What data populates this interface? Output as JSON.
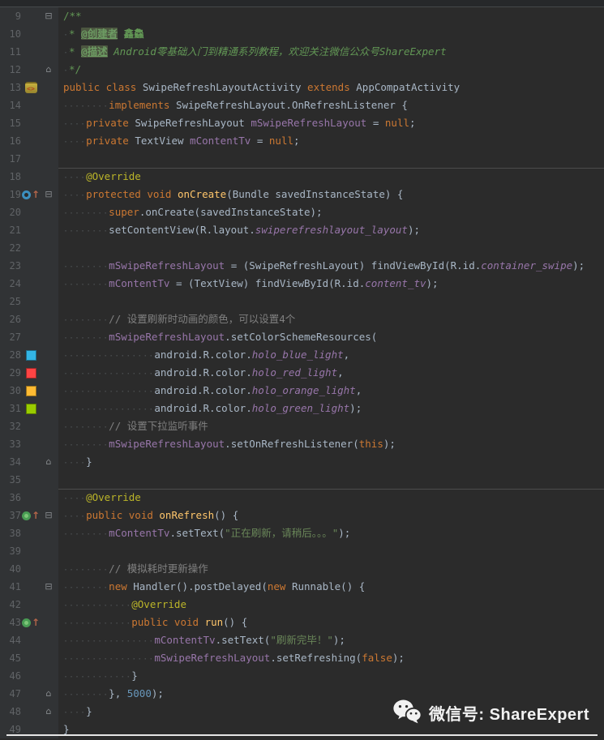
{
  "app_context": "IDE code editor (dark theme) showing Java Android source",
  "colors": {
    "background": "#2B2B2B",
    "gutter": "#313335",
    "line_number": "#606366",
    "keyword": "#CC7832",
    "plain": "#A9B7C6",
    "field": "#9876AA",
    "method_declaration": "#FFC66B",
    "annotation": "#BBB529",
    "string": "#6A8759",
    "number": "#6897BB",
    "comment": "#808080",
    "doc_comment": "#629755"
  },
  "icons": {
    "fold_collapse_glyph": "⊟",
    "fold_expand_glyph": "⌂",
    "override_arrow_glyph": "↑",
    "class_icon_glyph": "<>",
    "names": [
      "android-class-icon",
      "override-method-icon",
      "implement-method-icon",
      "fold-marker-icon",
      "color-swatch",
      "wechat-icon"
    ]
  },
  "watermark": {
    "label": "微信号: ShareExpert"
  },
  "editor": {
    "first_line": 9,
    "last_line": 49,
    "lines": [
      {
        "num": 9,
        "fold": "start",
        "segs": [
          [
            "doc",
            "/**"
          ]
        ]
      },
      {
        "num": 10,
        "segs": [
          [
            "ws",
            "·"
          ],
          [
            "doc",
            "* "
          ],
          [
            "docTag",
            "@创建者"
          ],
          [
            "doc",
            " "
          ],
          [
            "docB",
            "鑫鱻"
          ]
        ]
      },
      {
        "num": 11,
        "segs": [
          [
            "ws",
            "·"
          ],
          [
            "doc",
            "* "
          ],
          [
            "docTag",
            "@描述"
          ],
          [
            "doc",
            " "
          ],
          [
            "docI",
            "Android零基础入门到精通系列教程，欢迎关注微信公众号ShareExpert"
          ]
        ]
      },
      {
        "num": 12,
        "fold": "end",
        "segs": [
          [
            "ws",
            "·"
          ],
          [
            "doc",
            "*/"
          ]
        ]
      },
      {
        "num": 13,
        "icon": "class",
        "segs": [
          [
            "kw",
            "public class "
          ],
          [
            "plain",
            "SwipeRefreshLayoutActivity "
          ],
          [
            "kw",
            "extends "
          ],
          [
            "plain",
            "AppCompatActivity"
          ]
        ]
      },
      {
        "num": 14,
        "segs": [
          [
            "ws",
            "········"
          ],
          [
            "kw",
            "implements "
          ],
          [
            "plain",
            "SwipeRefreshLayout.OnRefreshListener {"
          ]
        ]
      },
      {
        "num": 15,
        "segs": [
          [
            "ws",
            "····"
          ],
          [
            "kw",
            "private "
          ],
          [
            "plain",
            "SwipeRefreshLayout "
          ],
          [
            "field",
            "mSwipeRefreshLayout"
          ],
          [
            "plain",
            " = "
          ],
          [
            "kw",
            "null"
          ],
          [
            "plain",
            ";"
          ]
        ]
      },
      {
        "num": 16,
        "segs": [
          [
            "ws",
            "····"
          ],
          [
            "kw",
            "private "
          ],
          [
            "plain",
            "TextView "
          ],
          [
            "field",
            "mContentTv"
          ],
          [
            "plain",
            " = "
          ],
          [
            "kw",
            "null"
          ],
          [
            "plain",
            ";"
          ]
        ]
      },
      {
        "num": 17,
        "segs": []
      },
      {
        "num": 18,
        "sep": true,
        "segs": [
          [
            "ws",
            "····"
          ],
          [
            "ann",
            "@Override"
          ]
        ]
      },
      {
        "num": 19,
        "icon": "override",
        "fold": "start",
        "segs": [
          [
            "ws",
            "····"
          ],
          [
            "kw",
            "protected void "
          ],
          [
            "method",
            "onCreate"
          ],
          [
            "plain",
            "(Bundle savedInstanceState) {"
          ]
        ]
      },
      {
        "num": 20,
        "segs": [
          [
            "ws",
            "········"
          ],
          [
            "kw",
            "super"
          ],
          [
            "plain",
            ".onCreate(savedInstanceState);"
          ]
        ]
      },
      {
        "num": 21,
        "segs": [
          [
            "ws",
            "········"
          ],
          [
            "plain",
            "setContentView(R.layout."
          ],
          [
            "fieldI",
            "swiperefreshlayout_layout"
          ],
          [
            "plain",
            ");"
          ]
        ]
      },
      {
        "num": 22,
        "segs": []
      },
      {
        "num": 23,
        "segs": [
          [
            "ws",
            "········"
          ],
          [
            "field",
            "mSwipeRefreshLayout"
          ],
          [
            "plain",
            " = (SwipeRefreshLayout) findViewById(R.id."
          ],
          [
            "fieldI",
            "container_swipe"
          ],
          [
            "plain",
            ");"
          ]
        ]
      },
      {
        "num": 24,
        "segs": [
          [
            "ws",
            "········"
          ],
          [
            "field",
            "mContentTv"
          ],
          [
            "plain",
            " = (TextView) findViewById(R.id."
          ],
          [
            "fieldI",
            "content_tv"
          ],
          [
            "plain",
            ");"
          ]
        ]
      },
      {
        "num": 25,
        "segs": []
      },
      {
        "num": 26,
        "segs": [
          [
            "ws",
            "········"
          ],
          [
            "cmt",
            "// 设置刷新时动画的颜色，可以设置4个"
          ]
        ]
      },
      {
        "num": 27,
        "segs": [
          [
            "ws",
            "········"
          ],
          [
            "field",
            "mSwipeRefreshLayout"
          ],
          [
            "plain",
            ".setColorSchemeResources("
          ]
        ]
      },
      {
        "num": 28,
        "swatch": "#33B5E5",
        "segs": [
          [
            "ws",
            "················"
          ],
          [
            "plain",
            "android.R.color."
          ],
          [
            "fieldI",
            "holo_blue_light"
          ],
          [
            "plain",
            ","
          ]
        ]
      },
      {
        "num": 29,
        "swatch": "#FF4444",
        "segs": [
          [
            "ws",
            "················"
          ],
          [
            "plain",
            "android.R.color."
          ],
          [
            "fieldI",
            "holo_red_light"
          ],
          [
            "plain",
            ","
          ]
        ]
      },
      {
        "num": 30,
        "swatch": "#FFBB33",
        "segs": [
          [
            "ws",
            "················"
          ],
          [
            "plain",
            "android.R.color."
          ],
          [
            "fieldI",
            "holo_orange_light"
          ],
          [
            "plain",
            ","
          ]
        ]
      },
      {
        "num": 31,
        "swatch": "#99CC00",
        "segs": [
          [
            "ws",
            "················"
          ],
          [
            "plain",
            "android.R.color."
          ],
          [
            "fieldI",
            "holo_green_light"
          ],
          [
            "plain",
            ");"
          ]
        ]
      },
      {
        "num": 32,
        "segs": [
          [
            "ws",
            "········"
          ],
          [
            "cmt",
            "// 设置下拉监听事件"
          ]
        ]
      },
      {
        "num": 33,
        "segs": [
          [
            "ws",
            "········"
          ],
          [
            "field",
            "mSwipeRefreshLayout"
          ],
          [
            "plain",
            ".setOnRefreshListener("
          ],
          [
            "kw",
            "this"
          ],
          [
            "plain",
            ");"
          ]
        ]
      },
      {
        "num": 34,
        "fold": "end",
        "segs": [
          [
            "ws",
            "····"
          ],
          [
            "plain",
            "}"
          ]
        ]
      },
      {
        "num": 35,
        "segs": []
      },
      {
        "num": 36,
        "sep": true,
        "segs": [
          [
            "ws",
            "····"
          ],
          [
            "ann",
            "@Override"
          ]
        ]
      },
      {
        "num": 37,
        "icon": "implement",
        "fold": "start",
        "segs": [
          [
            "ws",
            "····"
          ],
          [
            "kw",
            "public void "
          ],
          [
            "method",
            "onRefresh"
          ],
          [
            "plain",
            "() {"
          ]
        ]
      },
      {
        "num": 38,
        "segs": [
          [
            "ws",
            "········"
          ],
          [
            "field",
            "mContentTv"
          ],
          [
            "plain",
            ".setText("
          ],
          [
            "str",
            "\"正在刷新，请稍后。。。\""
          ],
          [
            "plain",
            ");"
          ]
        ]
      },
      {
        "num": 39,
        "segs": []
      },
      {
        "num": 40,
        "segs": [
          [
            "ws",
            "········"
          ],
          [
            "cmt",
            "// 模拟耗时更新操作"
          ]
        ]
      },
      {
        "num": 41,
        "fold": "start",
        "segs": [
          [
            "ws",
            "········"
          ],
          [
            "kw",
            "new "
          ],
          [
            "plain",
            "Handler().postDelayed("
          ],
          [
            "kw",
            "new"
          ],
          [
            "plain",
            " Runnable() {"
          ]
        ]
      },
      {
        "num": 42,
        "segs": [
          [
            "ws",
            "············"
          ],
          [
            "ann",
            "@Override"
          ]
        ]
      },
      {
        "num": 43,
        "icon": "implement",
        "segs": [
          [
            "ws",
            "············"
          ],
          [
            "kw",
            "public void "
          ],
          [
            "method",
            "run"
          ],
          [
            "plain",
            "() {"
          ]
        ]
      },
      {
        "num": 44,
        "segs": [
          [
            "ws",
            "················"
          ],
          [
            "field",
            "mContentTv"
          ],
          [
            "plain",
            ".setText("
          ],
          [
            "str",
            "\"刷新完毕！\""
          ],
          [
            "plain",
            ");"
          ]
        ]
      },
      {
        "num": 45,
        "segs": [
          [
            "ws",
            "················"
          ],
          [
            "field",
            "mSwipeRefreshLayout"
          ],
          [
            "plain",
            ".setRefreshing("
          ],
          [
            "kw",
            "false"
          ],
          [
            "plain",
            ");"
          ]
        ]
      },
      {
        "num": 46,
        "segs": [
          [
            "ws",
            "············"
          ],
          [
            "plain",
            "}"
          ]
        ]
      },
      {
        "num": 47,
        "fold": "end",
        "segs": [
          [
            "ws",
            "········"
          ],
          [
            "plain",
            "}, "
          ],
          [
            "number",
            "5000"
          ],
          [
            "plain",
            ");"
          ]
        ]
      },
      {
        "num": 48,
        "fold": "end",
        "segs": [
          [
            "ws",
            "····"
          ],
          [
            "plain",
            "}"
          ]
        ]
      },
      {
        "num": 49,
        "segs": [
          [
            "plain",
            "}"
          ]
        ]
      }
    ]
  }
}
